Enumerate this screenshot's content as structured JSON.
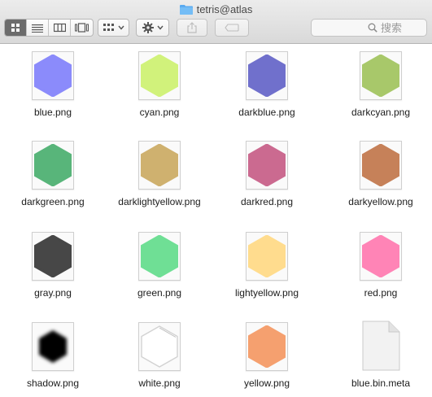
{
  "window": {
    "title": "tetris@atlas",
    "folder_icon": "folder-icon",
    "folder_color": "#5aaaf0"
  },
  "toolbar": {
    "view_buttons": [
      {
        "name": "icon-view-button",
        "icon": "grid-icon",
        "active": true
      },
      {
        "name": "list-view-button",
        "icon": "list-icon",
        "active": false
      },
      {
        "name": "column-view-button",
        "icon": "columns-icon",
        "active": false
      },
      {
        "name": "coverflow-view-button",
        "icon": "coverflow-icon",
        "active": false
      }
    ],
    "arrange_icon": "arrange-grid-icon",
    "action_icon": "gear-icon",
    "share_icon": "share-icon",
    "tags_icon": "tag-icon",
    "search": {
      "placeholder": "搜索",
      "value": ""
    }
  },
  "files": [
    {
      "label": "blue.png",
      "kind": "hex",
      "color": "#8b8bfb"
    },
    {
      "label": "cyan.png",
      "kind": "hex",
      "color": "#d1f27b"
    },
    {
      "label": "darkblue.png",
      "kind": "hex",
      "color": "#7070cc"
    },
    {
      "label": "darkcyan.png",
      "kind": "hex",
      "color": "#a8c86a"
    },
    {
      "label": "darkgreen.png",
      "kind": "hex",
      "color": "#58b57a"
    },
    {
      "label": "darklightyellow.png",
      "kind": "hex",
      "color": "#cfb16f"
    },
    {
      "label": "darkred.png",
      "kind": "hex",
      "color": "#cb6a90"
    },
    {
      "label": "darkyellow.png",
      "kind": "hex",
      "color": "#c68159"
    },
    {
      "label": "gray.png",
      "kind": "hex",
      "color": "#474747"
    },
    {
      "label": "green.png",
      "kind": "hex",
      "color": "#6fdf95"
    },
    {
      "label": "lightyellow.png",
      "kind": "hex",
      "color": "#ffdc8e"
    },
    {
      "label": "red.png",
      "kind": "hex",
      "color": "#ff84b6"
    },
    {
      "label": "shadow.png",
      "kind": "shadow",
      "color": "#000000"
    },
    {
      "label": "white.png",
      "kind": "outline",
      "color": "#ffffff"
    },
    {
      "label": "yellow.png",
      "kind": "hex",
      "color": "#f5a06f"
    },
    {
      "label": "blue.bin.meta",
      "kind": "document",
      "color": "#f2f2f2"
    }
  ]
}
